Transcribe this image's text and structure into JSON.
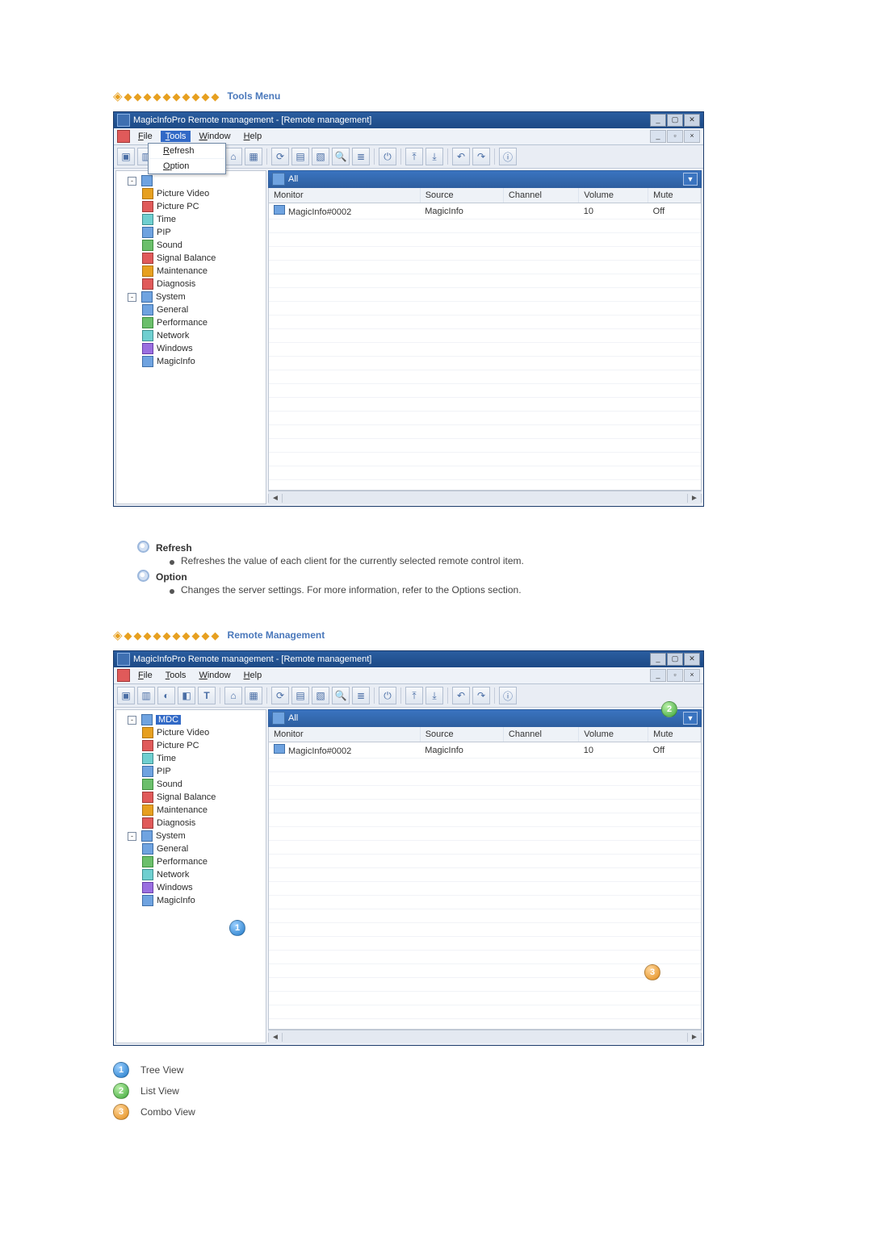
{
  "sections": {
    "tools_menu": {
      "title": "Tools Menu"
    },
    "remote_mgmt": {
      "title": "Remote Management"
    }
  },
  "window": {
    "title": "MagicInfoPro Remote management - [Remote management]",
    "menu": {
      "file": "File",
      "tools": "Tools",
      "window": "Window",
      "help": "Help"
    },
    "tools_dropdown": {
      "refresh": "Refresh",
      "option": "Option"
    },
    "group_bar": {
      "label": "All"
    },
    "columns": {
      "monitor": "Monitor",
      "source": "Source",
      "channel": "Channel",
      "volume": "Volume",
      "mute": "Mute"
    },
    "rows": [
      {
        "monitor": "MagicInfo#0002",
        "source": "MagicInfo",
        "channel": "",
        "volume": "10",
        "mute": "Off"
      }
    ],
    "tree": {
      "root_mdc": "MDC",
      "items": [
        "Picture Video",
        "Picture PC",
        "Time",
        "PIP",
        "Sound",
        "Signal Balance",
        "Maintenance",
        "Diagnosis"
      ],
      "system": "System",
      "system_items": [
        "General",
        "Performance",
        "Network",
        "Windows",
        "MagicInfo"
      ]
    }
  },
  "descriptions": {
    "refresh_label": "Refresh",
    "refresh_text": "Refreshes the value of each client for the currently selected remote control item.",
    "option_label": "Option",
    "option_text": "Changes the server settings. For more information, refer to the Options section."
  },
  "callouts": {
    "one": "1",
    "two": "2",
    "three": "3"
  },
  "legend": {
    "tree_view": "Tree View",
    "list_view": "List View",
    "combo_view": "Combo View"
  }
}
